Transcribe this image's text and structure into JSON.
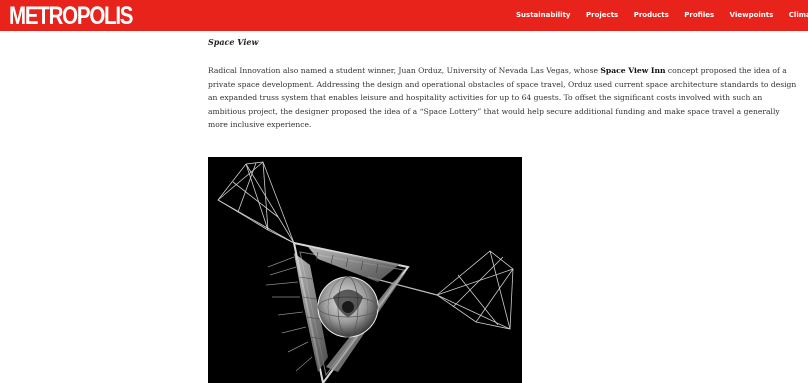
{
  "header": {
    "logo_text": "METROPOLIS",
    "brand_color": "#e8231c",
    "nav_items": [
      {
        "label": "Sustainability"
      },
      {
        "label": "Projects"
      },
      {
        "label": "Products"
      },
      {
        "label": "Profiles"
      },
      {
        "label": "Viewpoints"
      },
      {
        "label": "Climat"
      }
    ]
  },
  "article": {
    "heading": "Space View",
    "paragraph": {
      "before_bold": "Radical Innovation also named a student winner, Juan Orduz, University of Nevada Las Vegas, whose ",
      "bold": "Space View Inn",
      "after_bold": " concept proposed the idea of a private space development. Addressing the design and operational obstacles of space travel, Orduz used current space architecture standards to design an expanded truss system that enables leisure and hospitality activities for up to 64 guests. To offset the significant costs involved with such an ambitious project, the designer proposed the idea of a “Space Lottery” that would help secure additional funding and make space travel a generally more inclusive experience."
    },
    "figure": {
      "background": "#000000"
    }
  }
}
